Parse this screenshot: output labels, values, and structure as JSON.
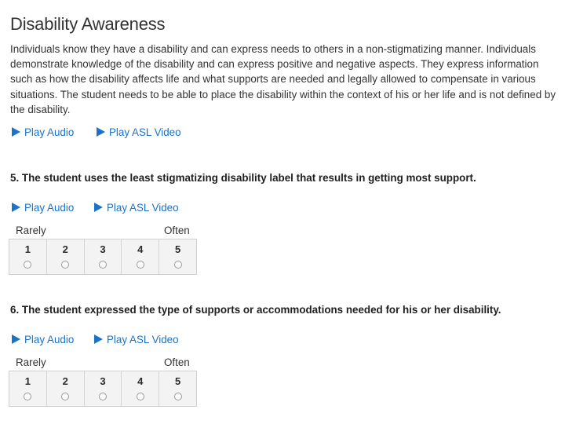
{
  "page": {
    "title": "Disability Awareness",
    "description": "Individuals know they have a disability and can express needs to others in a non-stigmatizing manner. Individuals demonstrate knowledge of the disability and can express positive and negative aspects. They express information such as how the disability affects life and what supports are needed and legally allowed to compensate in various situations. The student needs to be able to place the disability within the context of his or her life and is not defined by the disability."
  },
  "intro_media": {
    "audio_label": "Play Audio",
    "video_label": "Play ASL Video"
  },
  "questions": [
    {
      "text": "5. The student uses the least stigmatizing disability label that results in getting most support.",
      "audio_label": "Play Audio",
      "video_label": "Play ASL Video",
      "scale_low": "Rarely",
      "scale_high": "Often",
      "options": [
        "1",
        "2",
        "3",
        "4",
        "5"
      ]
    },
    {
      "text": "6. The student expressed the type of supports or accommodations needed for his or her disability.",
      "audio_label": "Play Audio",
      "video_label": "Play ASL Video",
      "scale_low": "Rarely",
      "scale_high": "Often",
      "options": [
        "1",
        "2",
        "3",
        "4",
        "5"
      ]
    }
  ],
  "icons": {
    "play": "play-icon"
  },
  "colors": {
    "link": "#1a73c9",
    "scale_bg": "#f3f3f3",
    "text": "#333333"
  }
}
